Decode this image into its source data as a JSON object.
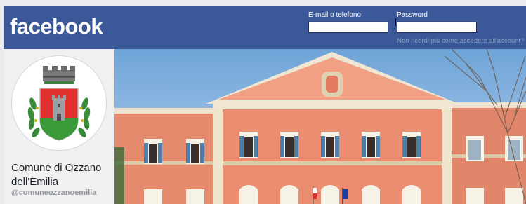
{
  "header": {
    "logo_text": "facebook",
    "email_label": "E-mail o telefono",
    "email_value": "",
    "password_label": "Password",
    "password_value": "",
    "forgot_link": "Non ricordi più come accedere all'account?"
  },
  "profile": {
    "name": "Comune di Ozzano dell'Emilia",
    "handle": "@comuneozzanoemilia",
    "avatar_icon": "municipal-coat-of-arms"
  },
  "cover": {
    "image": "town-hall-building-photo"
  },
  "colors": {
    "brand": "#3b5998",
    "link_muted": "#8b9dc3",
    "building": "#e9866a",
    "sky": "#a8c7e6"
  }
}
